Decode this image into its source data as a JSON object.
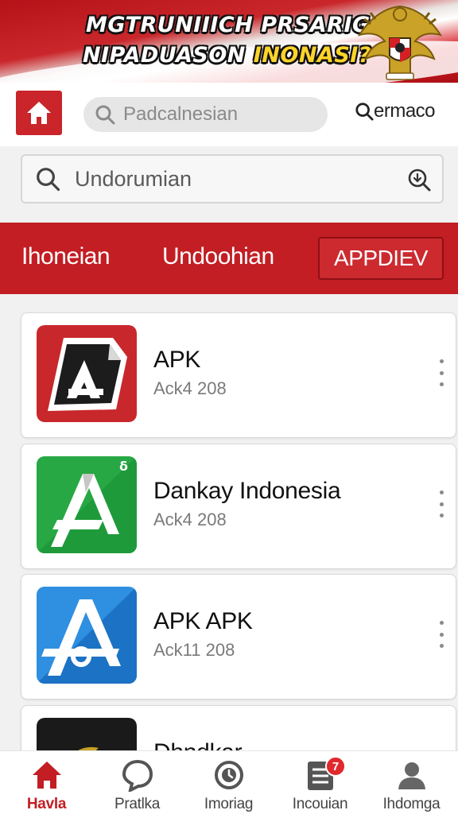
{
  "banner": {
    "line1": "MGTRUNIIICH PRSARIG",
    "line2_a": "NIPADUASON ",
    "line2_b": "INONASI?"
  },
  "header": {
    "search_placeholder": "Padcalnesian",
    "search_link_label": "ermaco"
  },
  "search": {
    "query": "Undorumian"
  },
  "tabs": [
    {
      "label": "Ihoneian"
    },
    {
      "label": "Undoohian"
    },
    {
      "label": "APPDIEV"
    }
  ],
  "apps": [
    {
      "name": "APK",
      "subtitle": "Ack4 208",
      "icon": "red-apk-icon"
    },
    {
      "name": "Dankay Indonesia",
      "subtitle": "Ack4 208",
      "icon": "green-apk-icon"
    },
    {
      "name": "APK APK",
      "subtitle": "Ack11 208",
      "icon": "blue-apk-icon"
    },
    {
      "name": "Dhndkar",
      "subtitle": "",
      "icon": "dark-gold-icon"
    }
  ],
  "bottom_nav": [
    {
      "label": "Havla",
      "icon": "home-icon",
      "active": true
    },
    {
      "label": "Pratlka",
      "icon": "chat-icon"
    },
    {
      "label": "Imoriag",
      "icon": "clock-icon"
    },
    {
      "label": "Incouian",
      "icon": "list-icon",
      "badge": "7"
    },
    {
      "label": "Ihdomga",
      "icon": "profile-icon"
    }
  ],
  "colors": {
    "primary_red": "#c21e24",
    "banner_yellow": "#ffd42a"
  }
}
